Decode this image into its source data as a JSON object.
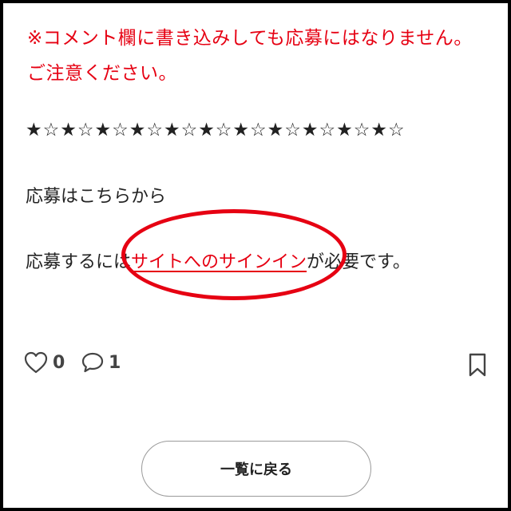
{
  "notice": {
    "line1": "※コメント欄に書き込みしても応募にはなりません。",
    "line2": "ご注意ください。"
  },
  "stars": "★☆★☆★☆★☆★☆★☆★☆★☆★☆★☆★☆",
  "apply": {
    "heading": "応募はこちらから",
    "prefix": "応募するには",
    "link_text": "サイトへのサインイン",
    "suffix": "が必要です。"
  },
  "actions": {
    "like_count": "0",
    "comment_count": "1"
  },
  "back_button_label": "一覧に戻る",
  "colors": {
    "accent_red": "#e60012",
    "text": "#222222",
    "icon_gray": "#444444",
    "frame": "#000000"
  }
}
